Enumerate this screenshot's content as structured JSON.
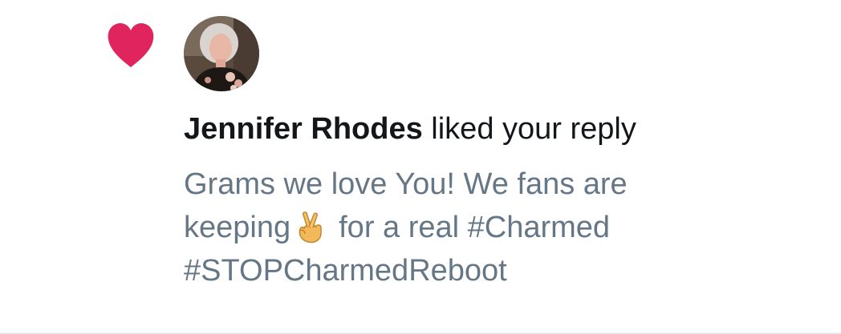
{
  "notification": {
    "type_icon": "heart-icon",
    "accent_color": "#e0245e",
    "avatar_icon": "user-avatar-photo",
    "user_name": "Jennifer Rhodes",
    "action_text": "liked your reply",
    "tweet": {
      "line1": "Grams we love You! We fans are",
      "line2_before": "keeping",
      "emoji": "crossed-fingers-emoji",
      "line2_after": "for a real #Charmed",
      "line3": "#STOPCharmedReboot"
    },
    "text_color": "#657786",
    "name_color": "#14171a"
  }
}
